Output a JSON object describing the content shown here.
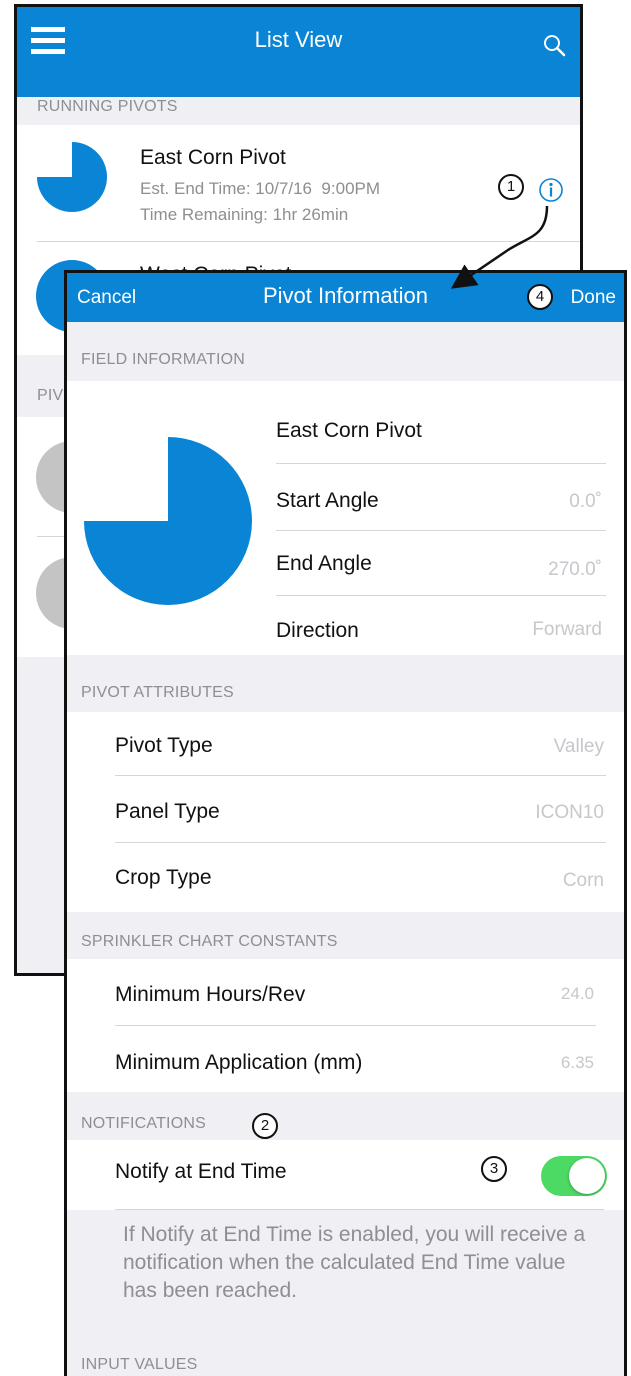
{
  "list_view": {
    "title": "List View",
    "running_pivots_header": "RUNNING PIVOTS",
    "pivots": [
      {
        "name": "East Corn Pivot",
        "end_time": "Est. End Time: 10/7/16  9:00PM",
        "remaining": "Time Remaining: 1hr 26min"
      },
      {
        "name": "West Corn Pivot"
      }
    ],
    "second_header_partial": "PIV"
  },
  "pivot_info": {
    "title": "Pivot Information",
    "cancel_label": "Cancel",
    "done_label": "Done",
    "field_information_header": "FIELD INFORMATION",
    "field_name": "East Corn Pivot",
    "start_angle_label": "Start Angle",
    "start_angle_value": "0.0˚",
    "end_angle_label": "End Angle",
    "end_angle_value": "270.0˚",
    "direction_label": "Direction",
    "direction_value": "Forward",
    "coverage_fraction": 0.75,
    "pivot_attributes_header": "PIVOT ATTRIBUTES",
    "pivot_type_label": "Pivot Type",
    "pivot_type_value": "Valley",
    "panel_type_label": "Panel Type",
    "panel_type_value": "ICON10",
    "crop_type_label": "Crop Type",
    "crop_type_value": "Corn",
    "sprinkler_header": "SPRINKLER CHART CONSTANTS",
    "min_hours_label": "Minimum Hours/Rev",
    "min_hours_value": "24.0",
    "min_application_label": "Minimum Application (mm)",
    "min_application_value": "6.35",
    "notifications_header": "NOTIFICATIONS",
    "notify_label": "Notify at End Time",
    "notify_enabled": true,
    "notify_description": "If Notify at End Time is enabled, you will receive a notification when the calculated End Time value has been reached.",
    "input_values_header": "INPUT VALUES"
  },
  "markers": {
    "m1": "1",
    "m2": "2",
    "m3": "3",
    "m4": "4"
  },
  "colors": {
    "accent": "#0a84d4",
    "toggle_on": "#4cd964",
    "inactive_gray": "#c4c4c4"
  },
  "icons": [
    "menu-icon",
    "search-icon",
    "info-icon",
    "pie-icon"
  ]
}
